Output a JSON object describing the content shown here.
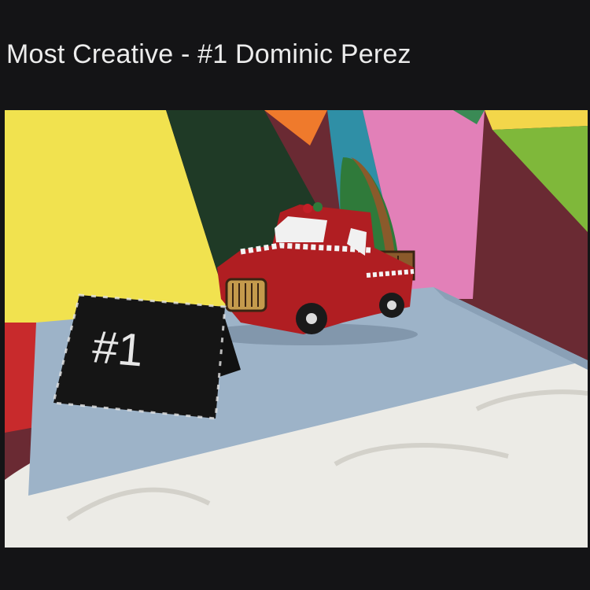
{
  "caption": "Most Creative - #1 Dominic Perez",
  "photo": {
    "icon": "gingerbread-truck-photo",
    "card_text": "#1",
    "colors": {
      "page_bg": "#141416",
      "wall_yellow": "#f1e24f",
      "wall_dark_green": "#1f3a26",
      "wall_teal": "#2f8fa6",
      "wall_pink": "#e280b8",
      "wall_orange": "#ef7a2c",
      "wall_lime": "#7fb83a",
      "wall_maroon": "#6a2a33",
      "wall_red": "#c82a2c",
      "board_blue": "#9db3c8",
      "cloth": "#ecebe6",
      "truck_red": "#b01e22"
    }
  }
}
